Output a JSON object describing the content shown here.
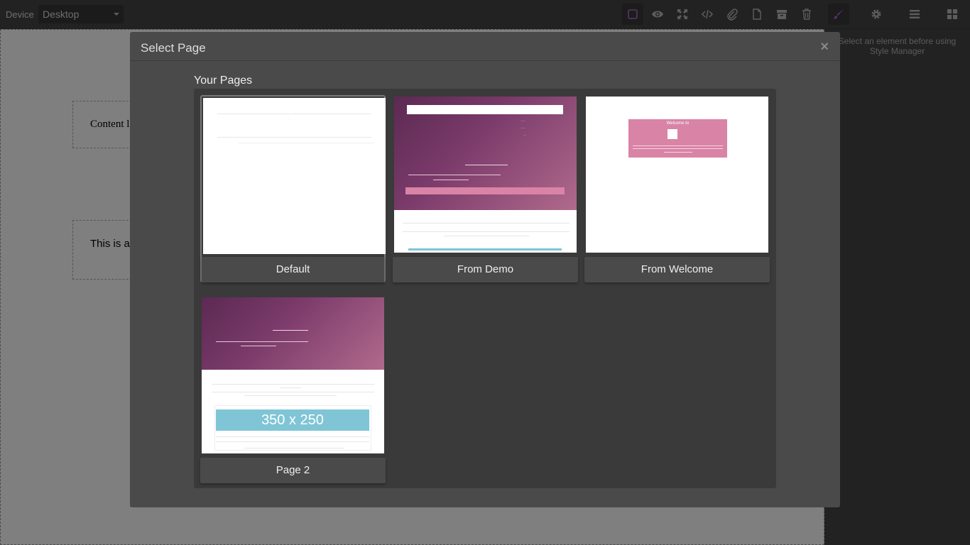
{
  "topbar": {
    "device_label": "Device",
    "device_value": "Desktop",
    "icons": [
      "square-outline-icon",
      "eye-icon",
      "fullscreen-icon",
      "code-icon",
      "paperclip-icon",
      "page-icon",
      "archive-icon",
      "trash-icon",
      "paintbrush-icon",
      "gear-icon",
      "layers-icon",
      "blocks-icon"
    ]
  },
  "right_panel": {
    "message": "Select an element before using Style Manager"
  },
  "canvas": {
    "box1_text": "Content l",
    "box2_text": "This is a reposito"
  },
  "modal": {
    "title": "Select Page",
    "close": "×",
    "section_title": "Your Pages",
    "pages": [
      {
        "label": "Default"
      },
      {
        "label": "From Demo"
      },
      {
        "label": "From Welcome"
      },
      {
        "label": "Page 2"
      }
    ],
    "welcome_thumb_title": "Welcome to",
    "page2_placeholder": "350 x 250"
  },
  "colors": {
    "accent_pink": "#d983a6",
    "placeholder_blue": "#7fc5d6",
    "brush_purple": "#b36ad0"
  }
}
